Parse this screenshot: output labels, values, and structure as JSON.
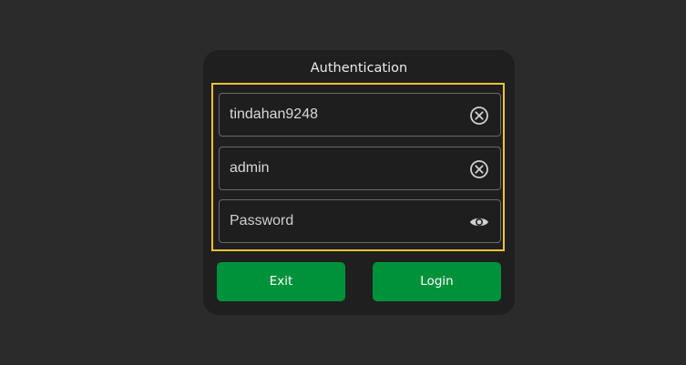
{
  "dialog": {
    "title": "Authentication"
  },
  "fields": {
    "device": {
      "value": "tindahan9248",
      "icon": "clear-icon"
    },
    "username": {
      "value": "admin",
      "icon": "clear-icon"
    },
    "password": {
      "placeholder": "Password",
      "icon": "eye-icon"
    }
  },
  "buttons": {
    "exit_label": "Exit",
    "login_label": "Login"
  },
  "colors": {
    "background": "#2b2b2b",
    "dialog": "#1f1f20",
    "focus_border": "#f2c230",
    "button": "#00923a"
  }
}
